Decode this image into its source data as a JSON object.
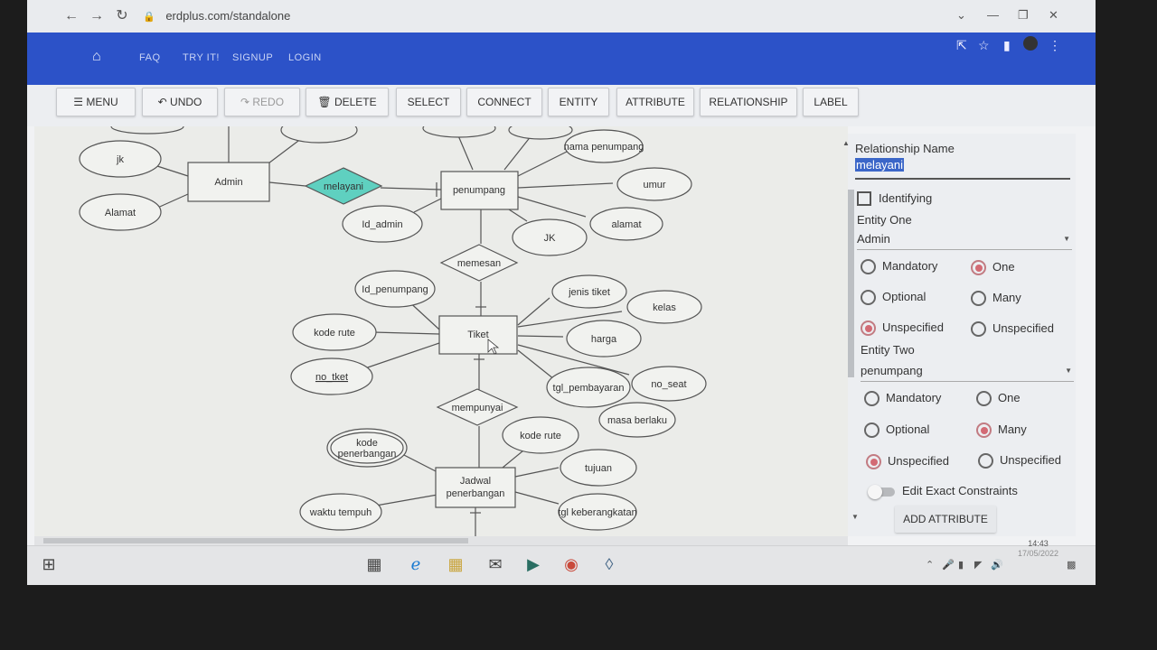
{
  "browser": {
    "url": "erdplus.com/standalone",
    "icons": [
      "back-icon",
      "forward-icon",
      "reload-icon",
      "lock-icon",
      "share-icon",
      "star-icon",
      "sidebar-icon",
      "profile-icon",
      "kebab-menu-icon"
    ]
  },
  "appbar": {
    "links": [
      "FAQ",
      "TRY IT!",
      "SIGNUP",
      "LOGIN"
    ],
    "color": "#2c52c8"
  },
  "toolbar": {
    "menu": "MENU",
    "undo": "UNDO",
    "redo": "REDO",
    "delete": "DELETE",
    "select": "SELECT",
    "connect": "CONNECT",
    "entity": "ENTITY",
    "attribute": "ATTRIBUTE",
    "relationship": "RELATIONSHIP",
    "label": "LABEL"
  },
  "diagram": {
    "entities": [
      {
        "name": "Admin"
      },
      {
        "name": "penumpang"
      },
      {
        "name": "Tiket"
      },
      {
        "name": "Jadwal\npenerbangan"
      }
    ],
    "relationships": [
      {
        "name": "melayani",
        "selected": true
      },
      {
        "name": "memesan"
      },
      {
        "name": "mempunyai"
      }
    ],
    "attributes": [
      "jk",
      "Alamat",
      "Id_admin",
      "nama penumpang",
      "umur",
      "alamat",
      "JK",
      "Id_penumpang",
      "jenis tiket",
      "kelas",
      "kode rute",
      "harga",
      "no_tket",
      "tgl_pembayaran",
      "no_seat",
      "masa berlaku",
      "kode\npenerbangan",
      "kode rute",
      "tujuan",
      "waktu tempuh",
      "tgl keberangkatan"
    ],
    "highlight_color": "#5fd0c0"
  },
  "panel": {
    "relationship_name_label": "Relationship Name",
    "relationship_name_value": "melayani",
    "identifying_label": "Identifying",
    "entity_one_label": "Entity One",
    "entity_one_value": "Admin",
    "entity_two_label": "Entity Two",
    "entity_two_value": "penumpang",
    "participation": [
      "Mandatory",
      "Optional",
      "Unspecified"
    ],
    "cardinality": [
      "One",
      "Many",
      "Unspecified"
    ],
    "entity_one_participation": "Unspecified",
    "entity_one_cardinality": "One",
    "entity_two_participation": "Unspecified",
    "entity_two_cardinality": "Many",
    "edit_exact_constraints": "Edit Exact Constraints",
    "add_attribute": "ADD ATTRIBUTE"
  },
  "taskbar": {
    "time": "14:43",
    "date": "17/05/2022",
    "icons": [
      "windows-start-icon",
      "task-view-icon",
      "edge-icon",
      "file-explorer-icon",
      "mail-icon",
      "store-icon",
      "chrome-icon",
      "app-icon"
    ]
  }
}
